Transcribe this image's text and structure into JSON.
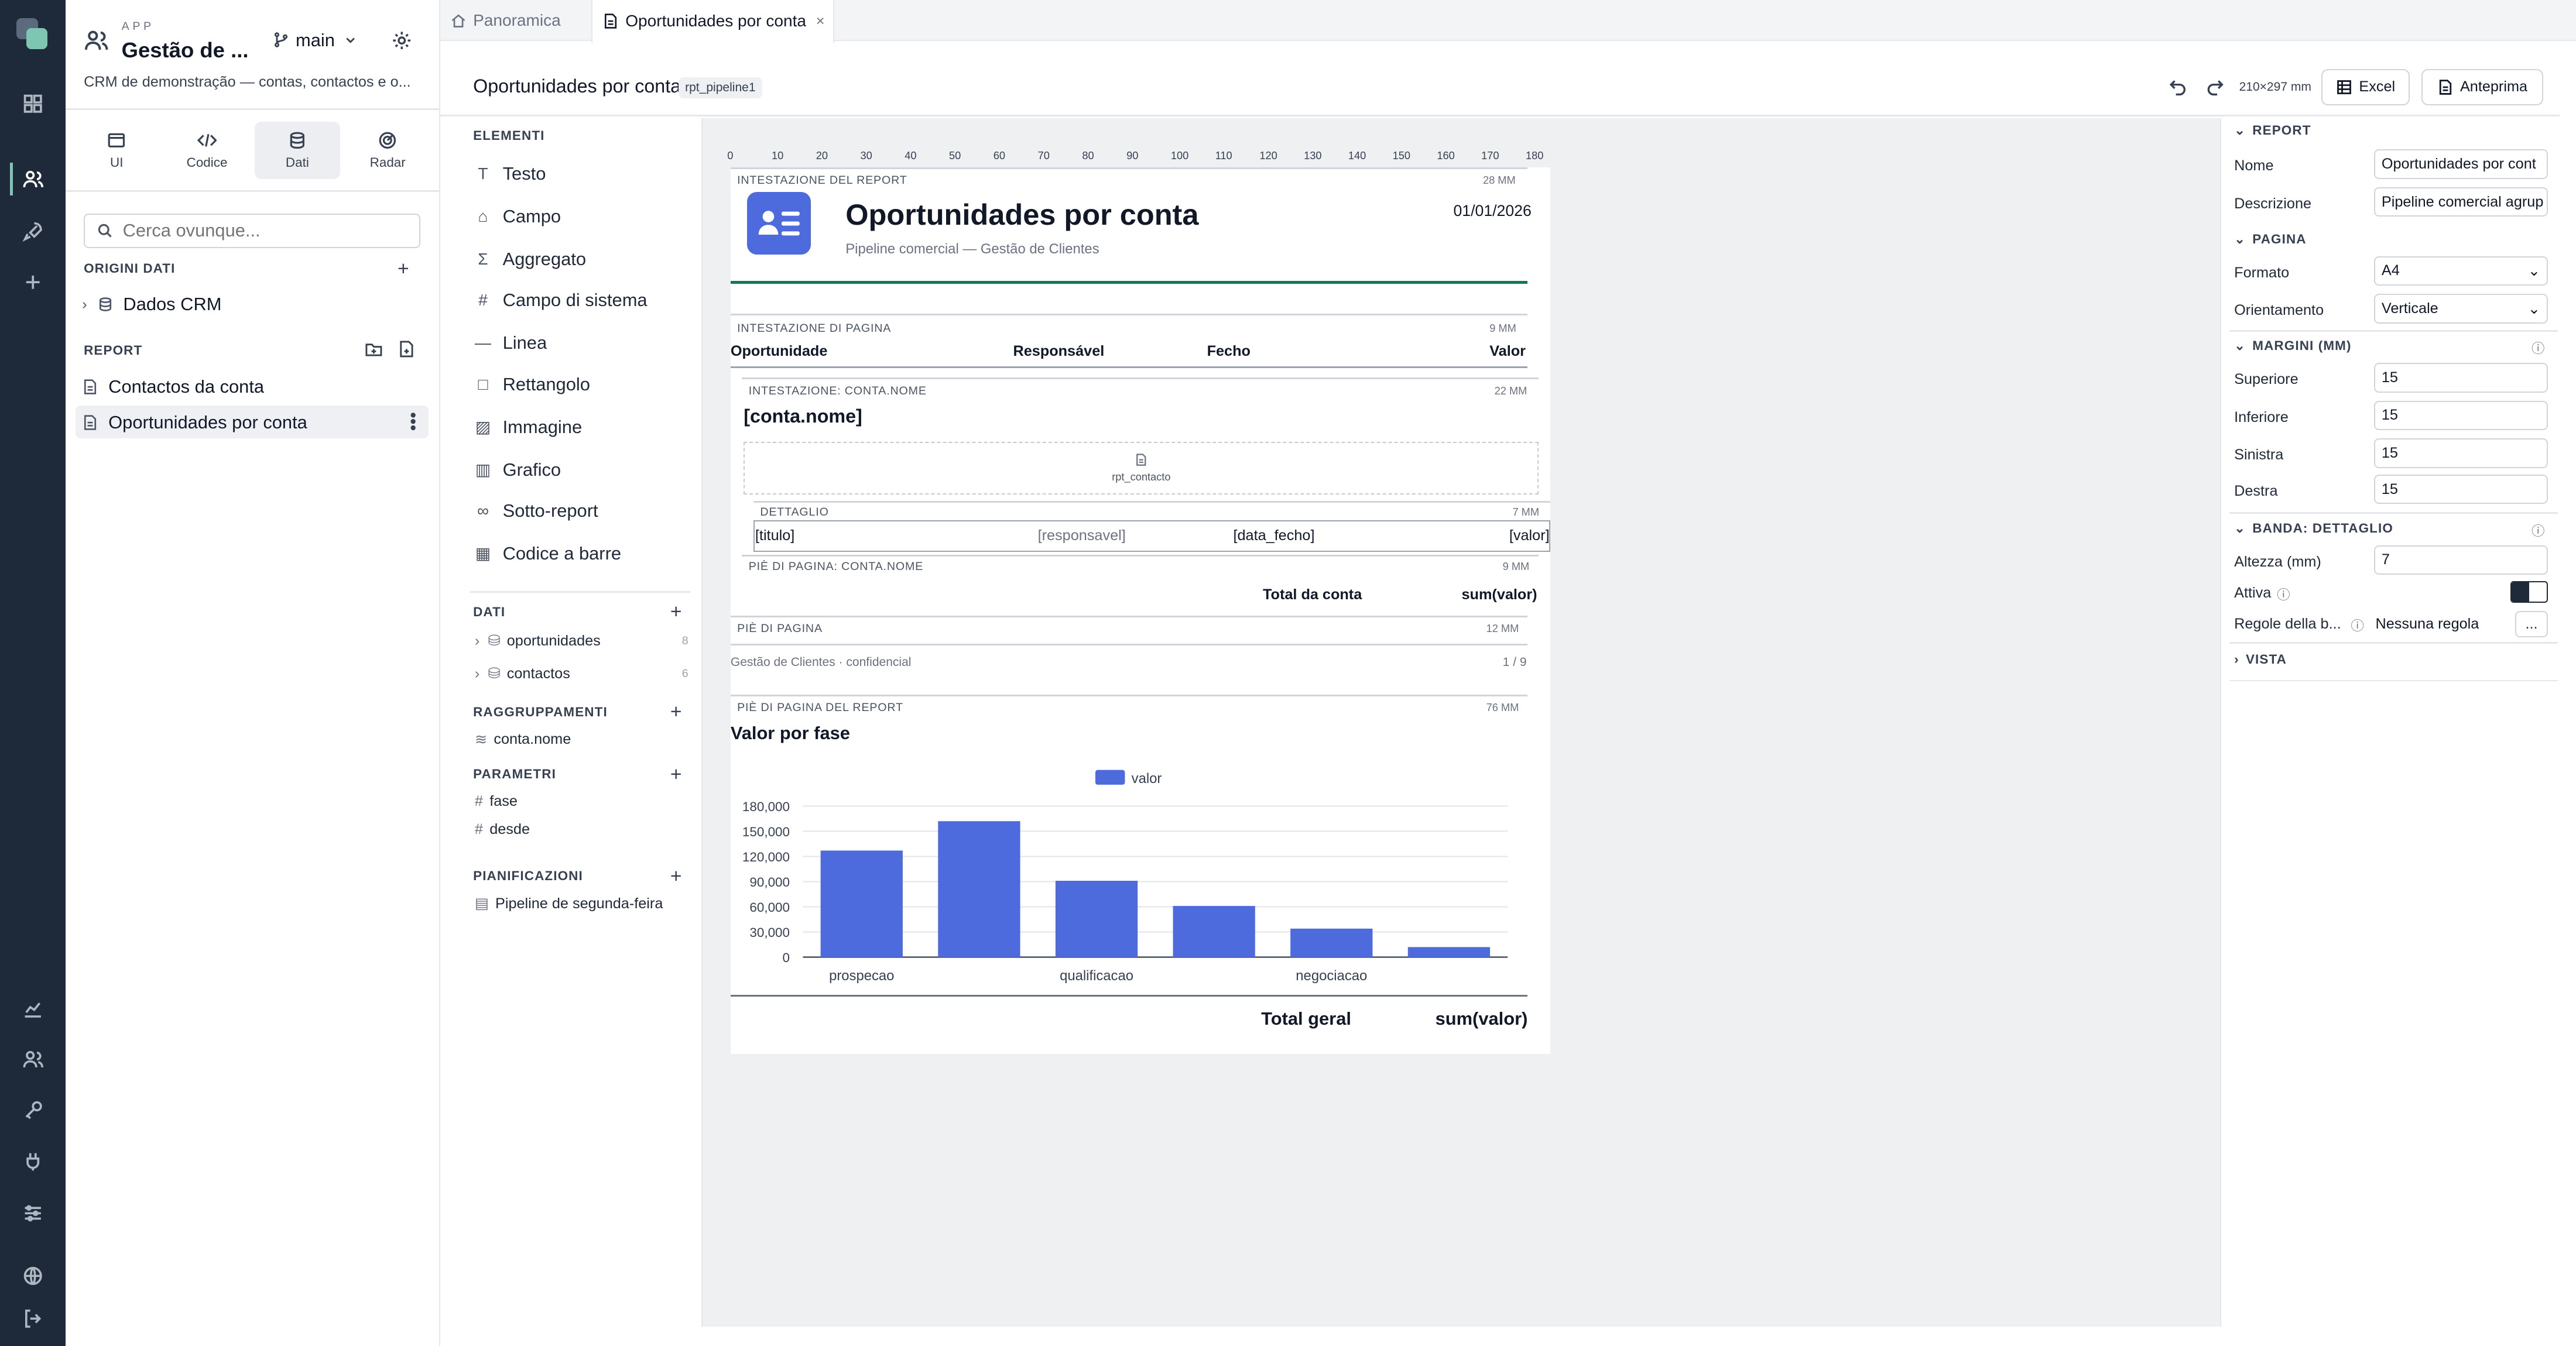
{
  "app": {
    "kicker": "APP",
    "name": "Gestão de ...",
    "branch": "main",
    "description": "CRM de demonstração — contas, contactos e o..."
  },
  "modes": [
    {
      "label": "UI"
    },
    {
      "label": "Codice"
    },
    {
      "label": "Dati"
    },
    {
      "label": "Radar"
    }
  ],
  "search": {
    "placeholder": "Cerca ovunque..."
  },
  "datasources": {
    "title": "ORIGINI DATI",
    "items": [
      "Dados CRM"
    ]
  },
  "reports": {
    "title": "REPORT",
    "items": [
      "Contactos da conta",
      "Oportunidades por conta"
    ]
  },
  "tabs": [
    {
      "label": "Panoramica"
    },
    {
      "label": "Oportunidades por conta",
      "close": "×"
    }
  ],
  "header": {
    "title": "Oportunidades por conta",
    "badge": "rpt_pipeline1",
    "page_size": "210×297 mm",
    "excel": "Excel",
    "preview": "Anteprima"
  },
  "palette": {
    "title": "ELEMENTI",
    "items": [
      "Testo",
      "Campo",
      "Aggregato",
      "Campo di sistema",
      "Linea",
      "Rettangolo",
      "Immagine",
      "Grafico",
      "Sotto-report",
      "Codice a barre"
    ],
    "data_title": "DATI",
    "data": [
      {
        "name": "oportunidades",
        "count": "8"
      },
      {
        "name": "contactos",
        "count": "6"
      }
    ],
    "groups_title": "RAGGRUPPAMENTI",
    "groups": [
      "conta.nome"
    ],
    "params_title": "PARAMETRI",
    "params": [
      "fase",
      "desde"
    ],
    "sched_title": "PIANIFICAZIONI",
    "schedules": [
      "Pipeline de segunda-feira"
    ]
  },
  "ruler": [
    "0",
    "10",
    "20",
    "30",
    "40",
    "50",
    "60",
    "70",
    "80",
    "90",
    "100",
    "110",
    "120",
    "130",
    "140",
    "150",
    "160",
    "170",
    "180"
  ],
  "report": {
    "rh": {
      "label": "INTESTAZIONE DEL REPORT",
      "mm": "28 MM",
      "title": "Oportunidades por conta",
      "subtitle": "Pipeline comercial — Gestão de Clientes",
      "date": "01/01/2026"
    },
    "ph": {
      "label": "INTESTAZIONE DI PAGINA",
      "mm": "9 MM",
      "cols": [
        "Oportunidade",
        "Responsável",
        "Fecho",
        "Valor"
      ]
    },
    "gh": {
      "label": "INTESTAZIONE: CONTA.NOME",
      "mm": "22 MM",
      "field": "[conta.nome]",
      "sub": "rpt_contacto"
    },
    "detail": {
      "label": "DETTAGLIO",
      "mm": "7 MM",
      "fields": [
        "[titulo]",
        "[responsavel]",
        "[data_fecho]",
        "[valor]"
      ]
    },
    "gf": {
      "label": "PIÈ DI PAGINA: CONTA.NOME",
      "mm": "9 MM",
      "text": "Total da conta",
      "agg": "sum(valor)"
    },
    "pf": {
      "label": "PIÈ DI PAGINA",
      "mm": "12 MM",
      "text": "Gestão de Clientes · confidencial",
      "pager": "1 / 9"
    },
    "rf": {
      "label": "PIÈ DI PAGINA DEL REPORT",
      "mm": "76 MM",
      "chart_title": "Valor por fase",
      "total": "Total geral",
      "agg": "sum(valor)"
    }
  },
  "chart_data": {
    "type": "bar",
    "title": "Valor por fase",
    "legend": [
      "valor"
    ],
    "categories": [
      "prospecao",
      "",
      "qualificacao",
      "",
      "negociacao",
      ""
    ],
    "x_tick_labels_shown": [
      "prospecao",
      "qualificacao",
      "negociacao"
    ],
    "series": [
      {
        "name": "valor",
        "values": [
          127000,
          162000,
          91000,
          61000,
          34000,
          12000
        ]
      }
    ],
    "yticks": [
      "180,000",
      "150,000",
      "120,000",
      "90,000",
      "60,000",
      "30,000",
      "0"
    ],
    "ylim": [
      0,
      180000
    ],
    "grid": true,
    "color": "#4d6bdc"
  },
  "props": {
    "report_title": "REPORT",
    "nome_label": "Nome",
    "nome": "Oportunidades por cont",
    "desc_label": "Descrizione",
    "desc": "Pipeline comercial agrup",
    "page_title": "PAGINA",
    "format_label": "Formato",
    "format": "A4",
    "orient_label": "Orientamento",
    "orient": "Verticale",
    "margins_title": "MARGINI (MM)",
    "top_label": "Superiore",
    "top": "15",
    "bottom_label": "Inferiore",
    "bottom": "15",
    "left_label": "Sinistra",
    "left": "15",
    "right_label": "Destra",
    "right": "15",
    "band_title": "BANDA: DETTAGLIO",
    "height_label": "Altezza (mm)",
    "height": "7",
    "active_label": "Attiva",
    "rules_label": "Regole della b...",
    "rules": "Nessuna regola",
    "rules_btn": "...",
    "view_title": "VISTA"
  },
  "colors": {
    "rail": "#1e2a3a",
    "accent": "#4d6bdc",
    "green": "#0f7a5a"
  }
}
